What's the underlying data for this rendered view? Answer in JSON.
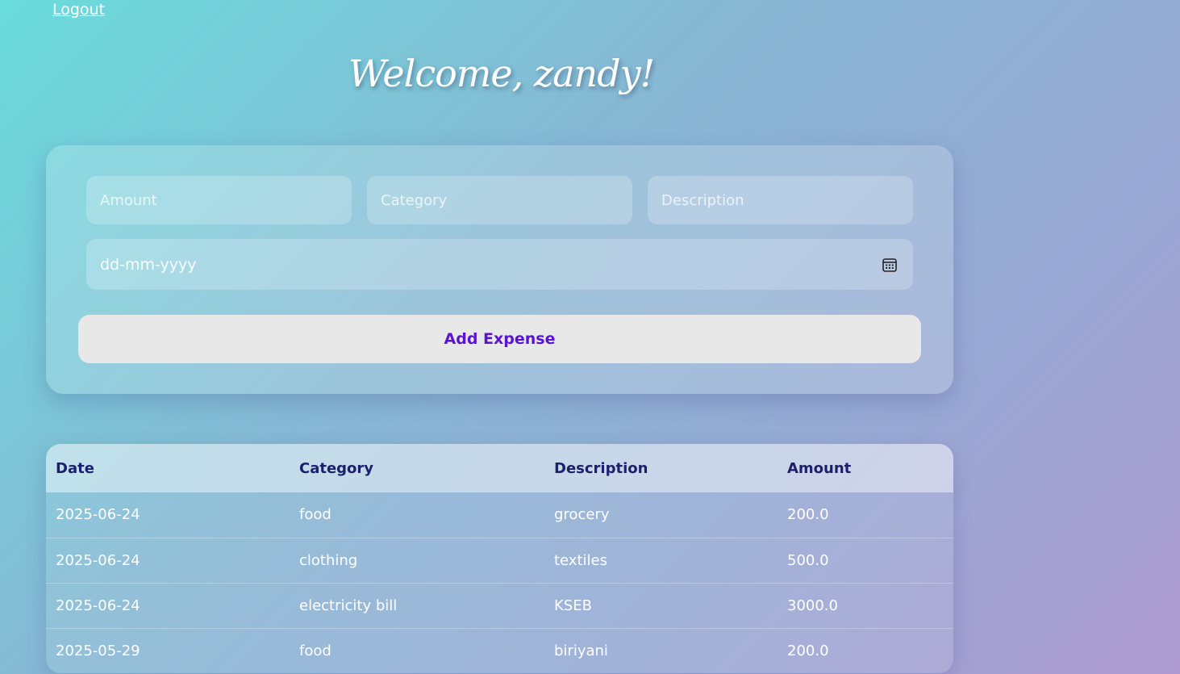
{
  "nav": {
    "logout_label": "Logout"
  },
  "header": {
    "welcome_text": "Welcome, zandy!"
  },
  "form": {
    "amount_placeholder": "Amount",
    "category_placeholder": "Category",
    "description_placeholder": "Description",
    "date_placeholder": "dd-mm-yyyy",
    "date_icon": "calendar-icon",
    "submit_label": "Add Expense"
  },
  "table": {
    "headers": [
      "Date",
      "Category",
      "Description",
      "Amount"
    ],
    "rows": [
      [
        "2025-06-24",
        "food",
        "grocery",
        "200.0"
      ],
      [
        "2025-06-24",
        "clothing",
        "textiles",
        "500.0"
      ],
      [
        "2025-06-24",
        "electricity bill",
        "KSEB",
        "3000.0"
      ],
      [
        "2025-05-29",
        "food",
        "biriyani",
        "200.0"
      ]
    ]
  },
  "colors": {
    "button_text": "#5a12d4",
    "header_text": "#1c1f6b",
    "button_bg": "#e8e8e8"
  }
}
